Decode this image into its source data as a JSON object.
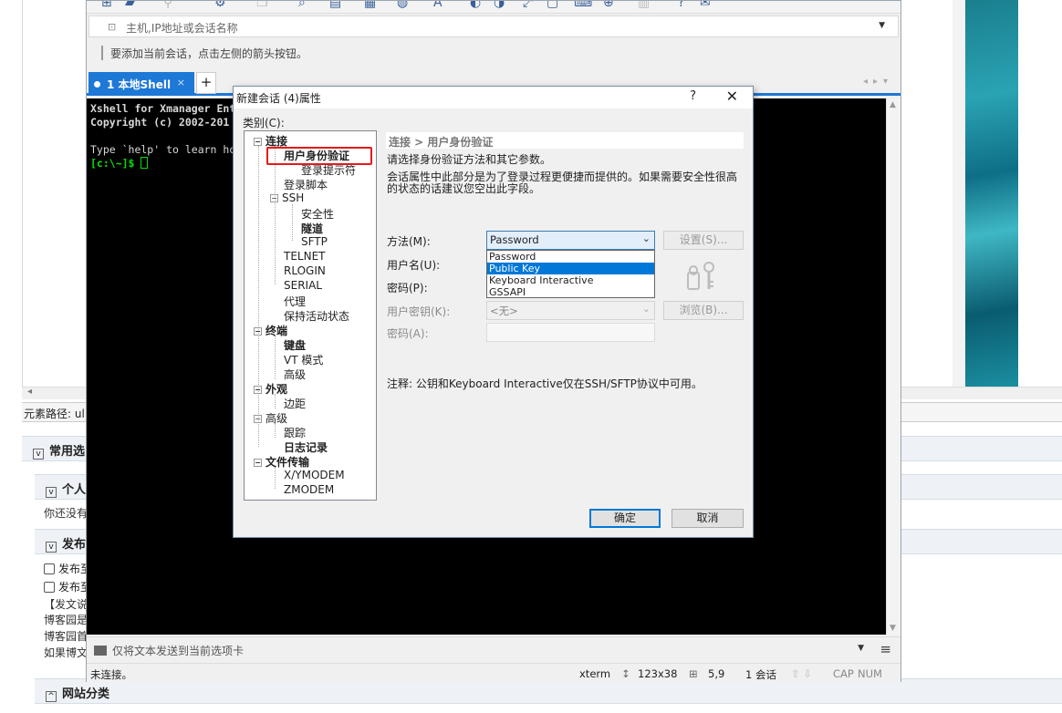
{
  "background_page": {
    "element_path": "元素路径: ul",
    "sections": {
      "common": "常用选",
      "personal": "个人",
      "publish": "发布",
      "site_categories": "网站分类"
    },
    "personal_text": "你还没有",
    "publish_checks": [
      "发布至",
      "发布至"
    ],
    "notes": [
      "【发文说",
      "博客园是",
      "博客园首",
      "如果博文"
    ]
  },
  "xshell": {
    "address_placeholder": "主机,IP地址或会话名称",
    "hint": "要添加当前会话，点击左侧的箭头按钮。",
    "tab_label": "1 本地Shell",
    "tab_close": "×",
    "tab_add": "+",
    "terminal": {
      "line1": "Xshell for Xmanager Ent",
      "line2": "Copyright (c) 2002-201",
      "line3": "Type `help' to learn ho",
      "prompt": "[c:\\~]$ "
    },
    "send_placeholder": "仅将文本发送到当前选项卡",
    "status": {
      "connection": "未连接。",
      "terminal_type": "xterm",
      "size": "123x38",
      "cursor": "5,9",
      "sessions": "1 会话",
      "cap": "CAP",
      "num": "NUM"
    }
  },
  "dialog": {
    "title": "新建会话 (4)属性",
    "help": "?",
    "close": "✕",
    "category_label": "类别(C):",
    "tree": {
      "connection": "连接",
      "user_auth": "用户身份验证",
      "login_prompt": "登录提示符",
      "login_script": "登录脚本",
      "ssh": "SSH",
      "security": "安全性",
      "tunnel": "隧道",
      "sftp": "SFTP",
      "telnet": "TELNET",
      "rlogin": "RLOGIN",
      "serial": "SERIAL",
      "proxy": "代理",
      "keepalive": "保持活动状态",
      "terminal": "终端",
      "keyboard": "键盘",
      "vt_mode": "VT 模式",
      "advanced1": "高级",
      "appearance": "外观",
      "margin": "边距",
      "advanced2": "高级",
      "trace": "跟踪",
      "log": "日志记录",
      "file_transfer": "文件传输",
      "xymodem": "X/YMODEM",
      "zmodem": "ZMODEM"
    },
    "breadcrumb": "连接 > 用户身份验证",
    "desc1": "请选择身份验证方法和其它参数。",
    "desc2": "会话属性中此部分是为了登录过程更便捷而提供的。如果需要安全性很高",
    "desc3": "的状态的话建议您空出此字段。",
    "method_label": "方法(M):",
    "method_value": "Password",
    "method_options": [
      "Password",
      "Public Key",
      "Keyboard Interactive",
      "GSSAPI"
    ],
    "method_selected_index": 1,
    "settings_button": "设置(S)...",
    "username_label": "用户名(U):",
    "password_label": "密码(P):",
    "user_key_label": "用户密钥(K):",
    "user_key_value": "<无>",
    "browse_button": "浏览(B)...",
    "passphrase_label": "密码(A):",
    "note": "注释: 公钥和Keyboard Interactive仅在SSH/SFTP协议中可用。",
    "ok_button": "确定",
    "cancel_button": "取消"
  },
  "colors": {
    "accent": "#1e78d6",
    "highlight_box": "#e21b1b",
    "selection": "#0078d7"
  }
}
